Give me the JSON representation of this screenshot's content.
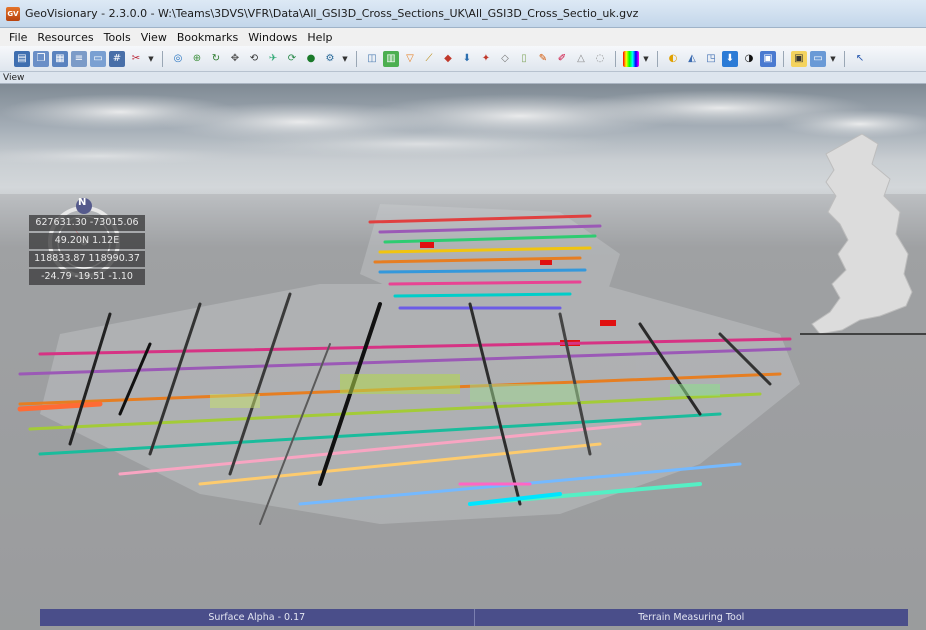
{
  "window": {
    "app_icon_text": "GV",
    "title": "GeoVisionary - 2.3.0.0 - W:\\Teams\\3DVS\\VFR\\Data\\All_GSI3D_Cross_Sections_UK\\All_GSI3D_Cross_Sectio_uk.gvz"
  },
  "menu": {
    "items": [
      "File",
      "Resources",
      "Tools",
      "View",
      "Bookmarks",
      "Windows",
      "Help"
    ]
  },
  "toolbar": {
    "groups": [
      [
        "save-icon",
        "copy-icon",
        "print-icon",
        "layers-icon",
        "image-icon",
        "grid-icon",
        "tools-icon"
      ],
      [
        "globe-search-icon",
        "zoom-icon",
        "rotate-icon",
        "pan-icon",
        "orbit-icon",
        "fly-icon",
        "refresh-icon",
        "marker-icon",
        "network-icon"
      ],
      [
        "section-icon",
        "chart-icon",
        "cone-icon",
        "ruler-icon",
        "palette-icon",
        "drill-icon",
        "pin-icon",
        "stack-icon",
        "eraser-icon",
        "pen-icon",
        "brush-icon",
        "shape-icon"
      ],
      [
        "color-bar-icon"
      ],
      [
        "camera-icon",
        "car-icon",
        "export-icon",
        "download-icon",
        "contrast-icon",
        "settings-icon"
      ],
      [
        "screen-icon",
        "monitor-icon"
      ],
      [
        "cursor-icon"
      ]
    ]
  },
  "view": {
    "label": "View"
  },
  "compass": {
    "north_label": "N"
  },
  "coordinates": {
    "rows": [
      "627631.30 -73015.06",
      "49.20N 1.12E",
      "118833.87 118990.37",
      "-24.79 -19.51 -1.10"
    ]
  },
  "status": {
    "surface_alpha": "Surface Alpha - 0.17",
    "tool": "Terrain Measuring Tool"
  }
}
